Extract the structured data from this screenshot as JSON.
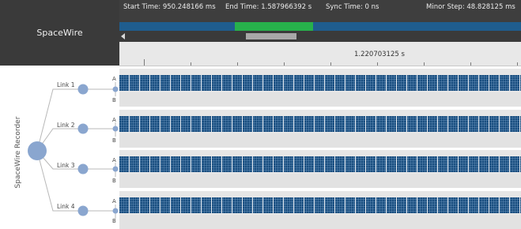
{
  "app": {
    "title": "SpaceWire"
  },
  "header": {
    "start_time": "Start Time: 950.248166 ms",
    "end_time": "End Time: 1.587966392 s",
    "sync_time": "Sync Time: 0 ns",
    "minor_step": "Minor Step: 48.828125 ms"
  },
  "overview": {
    "window_start_fraction": 0.287,
    "window_end_fraction": 0.482,
    "window_color": "#27b14b",
    "track_color": "#1f5d8e"
  },
  "scrollbar": {
    "left_arrow_icon": "chevron-left-icon",
    "thumb_start_fraction": 0.315,
    "thumb_end_fraction": 0.441
  },
  "ruler": {
    "center_label": "1.220703125 s"
  },
  "tree": {
    "root_label": "SpaceWire Recorder",
    "links": [
      {
        "label": "Link 1",
        "port_a": "A",
        "port_b": "B"
      },
      {
        "label": "Link 2",
        "port_a": "A",
        "port_b": "B"
      },
      {
        "label": "Link 3",
        "port_a": "A",
        "port_b": "B"
      },
      {
        "label": "Link 4",
        "port_a": "A",
        "port_b": "B"
      }
    ]
  },
  "colors": {
    "activity": "#1a4f80",
    "panel_dark": "#3a3a3a",
    "node": "#8aa6cf"
  }
}
